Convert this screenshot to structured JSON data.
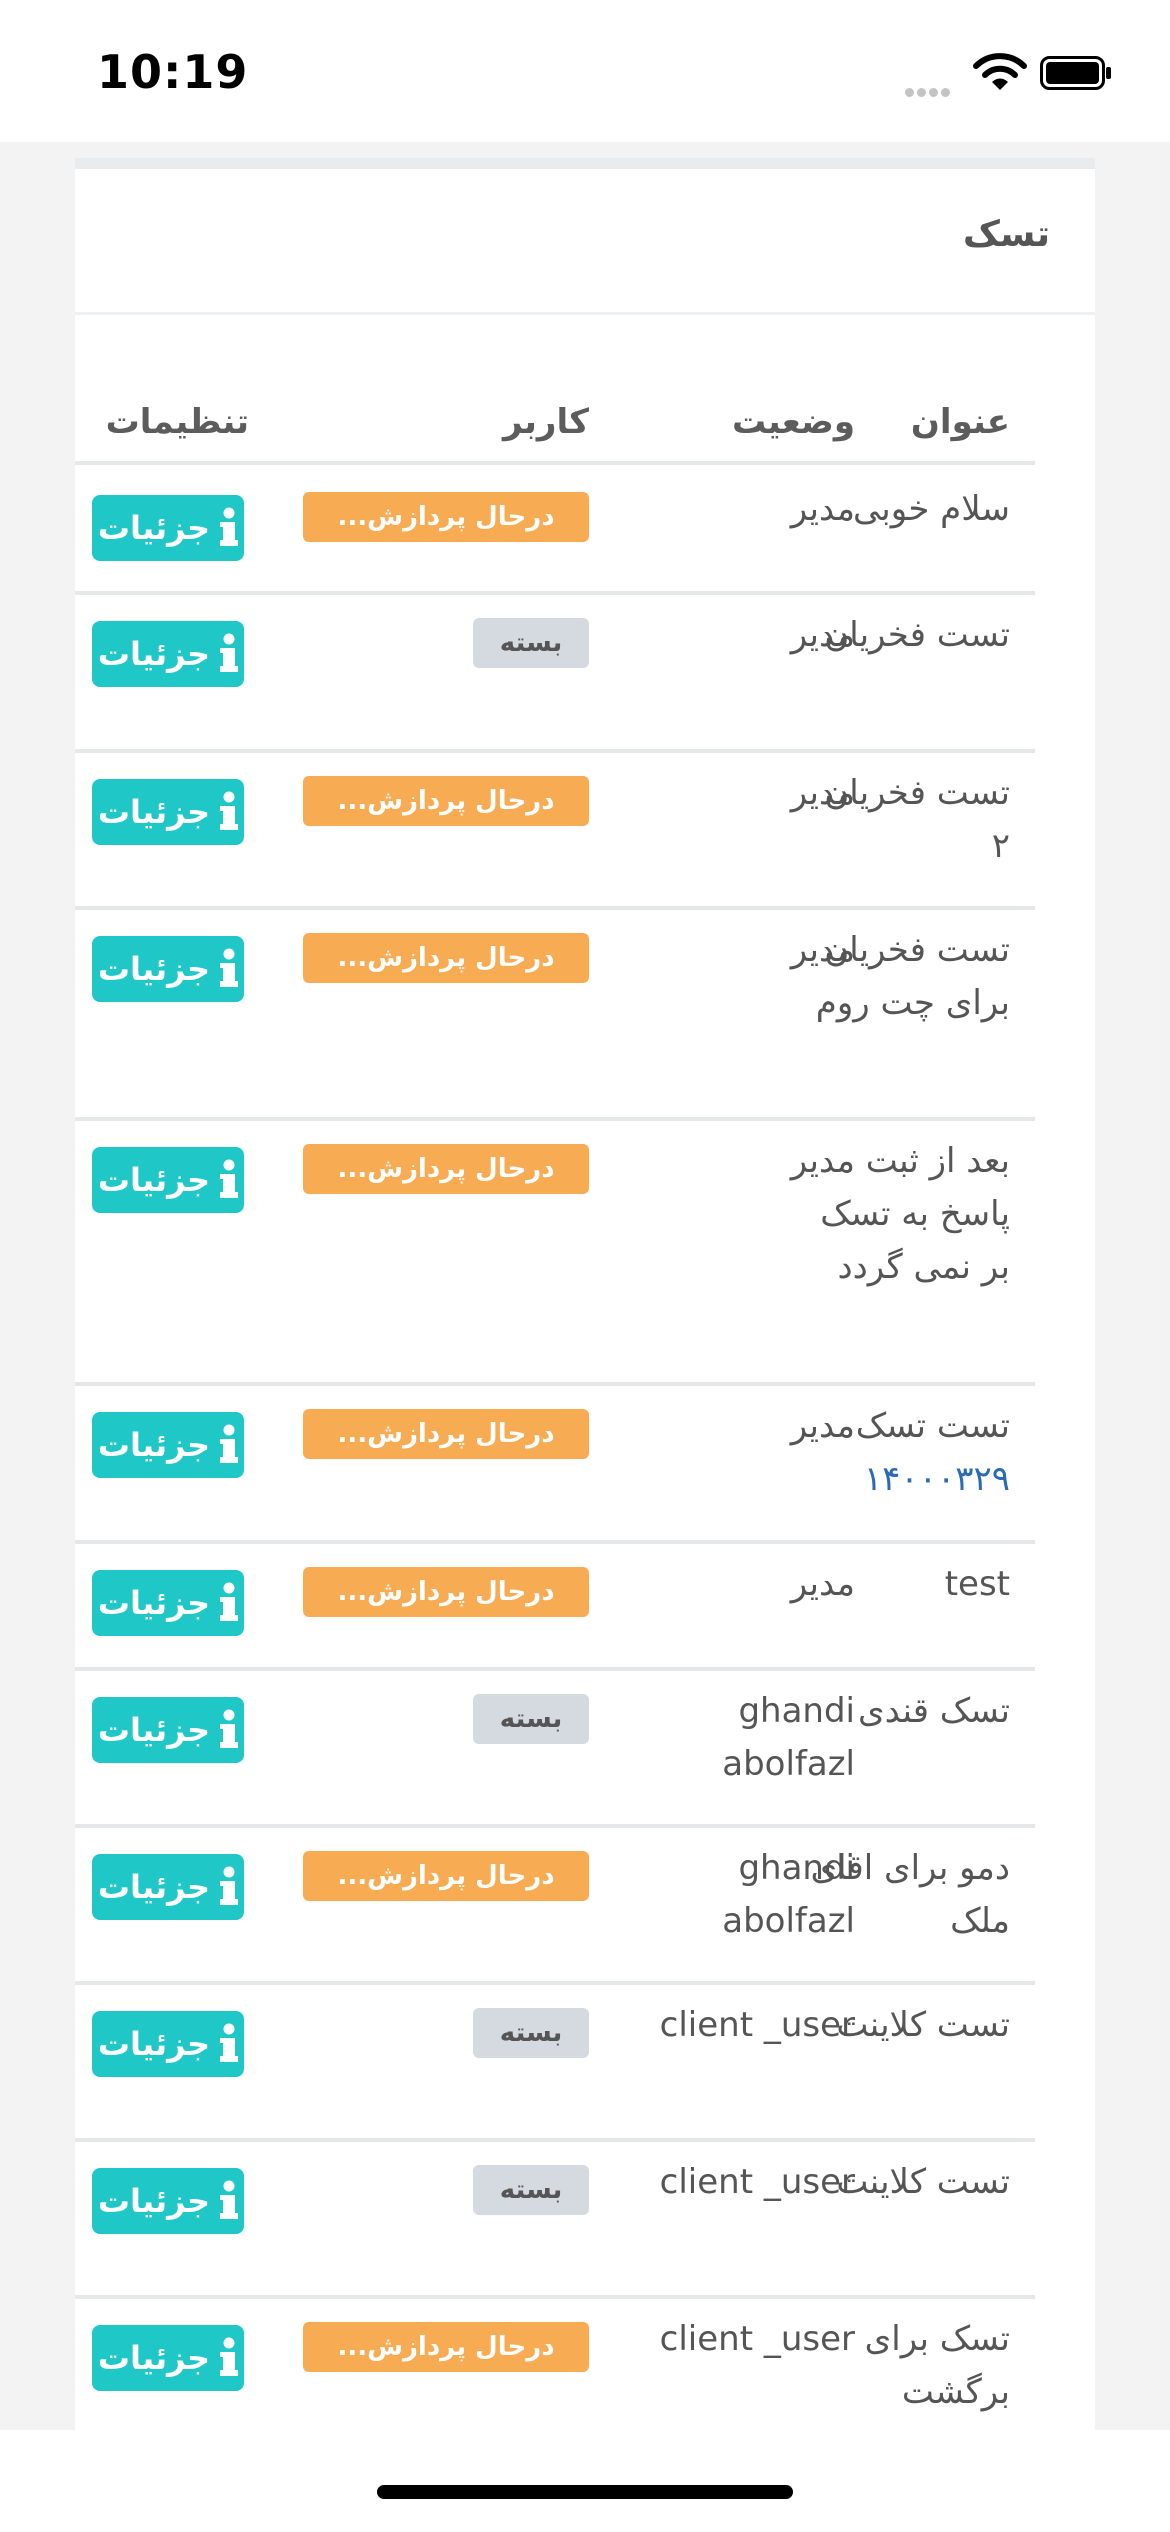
{
  "status_bar": {
    "time": "10:19"
  },
  "card": {
    "title": "تسک"
  },
  "table": {
    "headers": {
      "title": "عنوان",
      "status": "وضعیت",
      "user": "کاربر",
      "settings": "تنظیمات"
    },
    "details_label": "جزئیات",
    "rows": [
      {
        "title": "سلام خوبی",
        "status": "مدیر",
        "badge": "درحال پردازش...",
        "badge_type": "processing"
      },
      {
        "title": "تست فخریان",
        "status": "مدیر",
        "badge": "بسته",
        "badge_type": "closed"
      },
      {
        "title": "تست فخریان ۲",
        "status": "مدیر",
        "badge": "درحال پردازش...",
        "badge_type": "processing"
      },
      {
        "title": "تست فخریان برای چت روم",
        "status": "مدیر",
        "badge": "درحال پردازش...",
        "badge_type": "processing"
      },
      {
        "title": "بعد از ثبت پاسخ به تسک بر نمی گردد",
        "status": "مدیر",
        "badge": "درحال پردازش...",
        "badge_type": "processing"
      },
      {
        "title": "تست تسک",
        "title_number": "۱۴۰۰۰۳۲۹",
        "status": "مدیر",
        "badge": "درحال پردازش...",
        "badge_type": "processing"
      },
      {
        "title": "test",
        "status": "مدیر",
        "badge": "درحال پردازش...",
        "badge_type": "processing"
      },
      {
        "title": "تسک قندی",
        "status": "ghandi abolfazl",
        "badge": "بسته",
        "badge_type": "closed"
      },
      {
        "title": "دمو برای اقای ملک",
        "status": "ghandi abolfazl",
        "badge": "درحال پردازش...",
        "badge_type": "processing"
      },
      {
        "title": "تست کلاینت",
        "status": "client _user",
        "badge": "بسته",
        "badge_type": "closed"
      },
      {
        "title": "تست کلاینت",
        "status": "client _user",
        "badge": "بسته",
        "badge_type": "closed"
      },
      {
        "title": "تسک برای برگشت",
        "status": "client _user",
        "badge": "درحال پردازش...",
        "badge_type": "processing"
      }
    ]
  },
  "colors": {
    "details_button": "#1fc7c7",
    "processing_badge": "#f7ab53",
    "closed_badge": "#d4dadf",
    "link_number": "#2a6ab6"
  }
}
